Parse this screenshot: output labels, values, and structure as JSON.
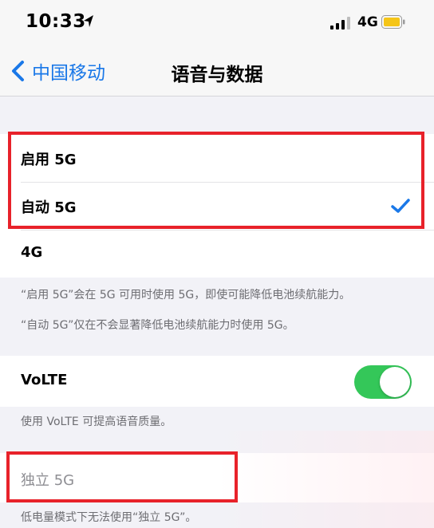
{
  "status_bar": {
    "time": "10:33",
    "location_icon": "location-arrow-icon",
    "signal_icon": "cellular-signal-icon",
    "network": "4G",
    "battery_icon": "battery-icon",
    "battery_color": "#f5c518"
  },
  "nav": {
    "back_label": "中国移动",
    "title": "语音与数据",
    "accent_color": "#1a78e8"
  },
  "options": [
    {
      "label": "启用 5G",
      "selected": false
    },
    {
      "label": "自动 5G",
      "selected": true
    },
    {
      "label": "4G",
      "selected": false
    }
  ],
  "notes": [
    "“启用 5G”会在 5G 可用时使用 5G，即使可能降低电池续航能力。",
    "“自动 5G”仅在不会显著降低电池续航能力时使用 5G。"
  ],
  "volte": {
    "label": "VoLTE",
    "enabled": true,
    "note": "使用 VoLTE 可提高语音质量。",
    "toggle_color": "#34c759"
  },
  "standalone": {
    "label": "独立 5G",
    "note": "低电量模式下无法使用“独立 5G”。"
  },
  "highlight_color": "#e8222a"
}
